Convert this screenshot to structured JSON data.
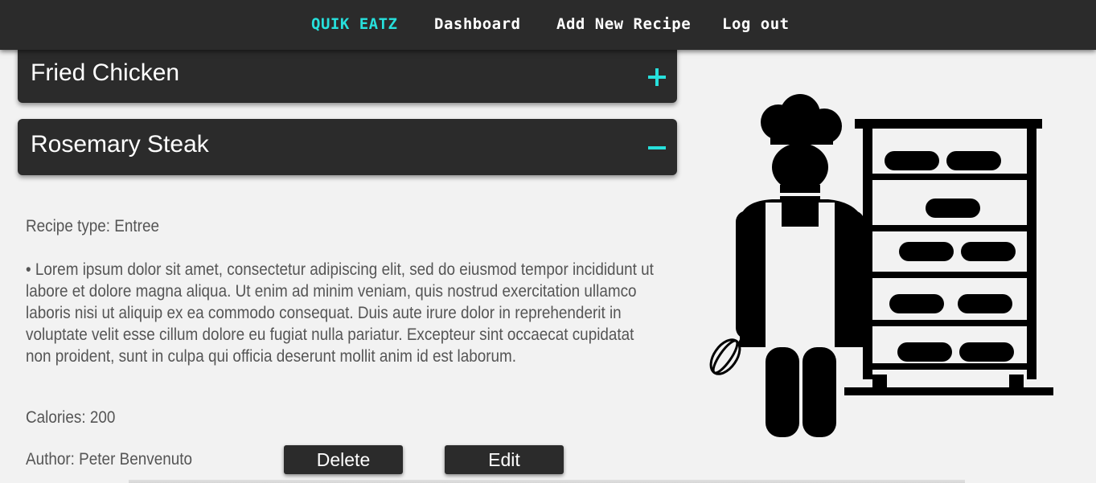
{
  "nav": {
    "brand": "QUIK EATZ",
    "dashboard": "Dashboard",
    "add_recipe": "Add New Recipe",
    "logout": "Log out"
  },
  "colors": {
    "accent": "#27e0dc",
    "dark": "#2b2b2b",
    "background": "#f2f2f2",
    "text": "#555555"
  },
  "recipes": [
    {
      "name": "Fried Chicken",
      "toggle_icon": "plus-icon",
      "expanded": false
    },
    {
      "name": "Rosemary Steak",
      "toggle_icon": "minus-icon",
      "expanded": true
    }
  ],
  "detail": {
    "type": "Recipe type: Entree",
    "description": "• Lorem ipsum dolor sit amet, consectetur adipiscing elit, sed do eiusmod tempor incididunt ut labore et dolore magna aliqua. Ut enim ad minim veniam, quis nostrud exercitation ullamco laboris nisi ut aliquip ex ea commodo consequat. Duis aute irure dolor in reprehenderit in voluptate velit esse cillum dolore eu fugiat nulla pariatur. Excepteur sint occaecat cupidatat non proident, sunt in culpa qui officia deserunt mollit anim id est laborum.",
    "calories": "Calories: 200",
    "author": "Author: Peter Benvenuto"
  },
  "actions": {
    "delete": "Delete",
    "edit": "Edit"
  },
  "illustration": "baker-with-bread-rack-icon"
}
